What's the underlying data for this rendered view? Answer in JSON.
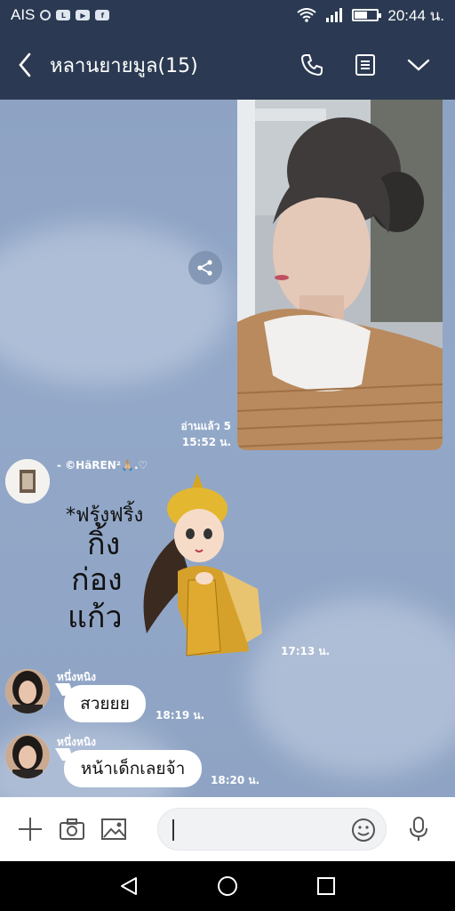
{
  "status_bar": {
    "carrier": "AIS",
    "time": "20:44 น.",
    "battery_level": 0.6,
    "icons": [
      "sync-icon",
      "line-icon",
      "youtube-icon",
      "facebook-icon",
      "wifi-icon",
      "signal-icon",
      "battery-icon"
    ]
  },
  "header": {
    "title": "หลานยายมูล(15)",
    "icons": [
      "back-arrow-icon",
      "phone-icon",
      "notes-icon",
      "chevron-down-icon"
    ]
  },
  "colors": {
    "header_bg": "#2b3a52",
    "chat_bg": "#8ea3c4",
    "bubble_bg": "#ffffff",
    "text_white": "#ffffff"
  },
  "messages": {
    "photo": {
      "read": "อ่านแล้ว 5",
      "time": "15:52 น."
    },
    "sticker_msg": {
      "sender": "- ©HäREN²🙏🏼.♡",
      "sticker_lines": [
        "*ฟรุ้งฟริ้ง",
        "กิ้ง",
        "ก่อง",
        "แก้ว"
      ],
      "time": "17:13 น."
    },
    "msg1": {
      "sender": "หนึ่งหนิง",
      "text": "สวยยย",
      "time": "18:19 น."
    },
    "msg2": {
      "sender": "หนึ่งหนิง",
      "text": "หน้าเด็กเลยจ้า",
      "time": "18:20 น."
    }
  },
  "input_bar": {
    "placeholder": "",
    "icons": [
      "plus-icon",
      "camera-icon",
      "image-icon",
      "emoji-icon",
      "mic-icon"
    ]
  },
  "nav_bar": {
    "icons": [
      "nav-back-icon",
      "nav-home-icon",
      "nav-recents-icon"
    ]
  }
}
